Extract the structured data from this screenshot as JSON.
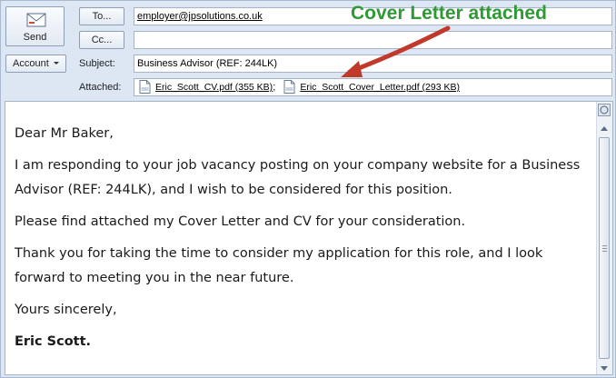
{
  "header": {
    "send_label": "Send",
    "account_label": "Account",
    "to_label": "To...",
    "cc_label": "Cc...",
    "subject_label": "Subject:",
    "attached_label": "Attached:",
    "to_value": "employer@jpsolutions.co.uk",
    "cc_value": "",
    "subject_value": "Business Advisor (REF: 244LK)",
    "attachments": [
      {
        "name": "Eric_Scott_CV.pdf (355 KB)",
        "icon": "pdf-icon"
      },
      {
        "name": "Eric_Scott_Cover_Letter.pdf (293 KB)",
        "icon": "pdf-icon"
      }
    ],
    "attachment_separator": ";"
  },
  "annotation": {
    "text": "Cover Letter attached",
    "color": "#2f9a35",
    "arrow_color": "#c0392b"
  },
  "body": {
    "greeting": "Dear Mr Baker,",
    "paragraph1": "I am responding to your job vacancy posting on your company website for a Business Advisor (REF: 244LK), and I wish to be considered for this position.",
    "paragraph2": "Please find attached my Cover Letter and CV for your consideration.",
    "paragraph3": "Thank you for taking the time to consider my application for this role, and I look forward to meeting you in the near future.",
    "closing": "Yours sincerely,",
    "signature": "Eric Scott."
  }
}
